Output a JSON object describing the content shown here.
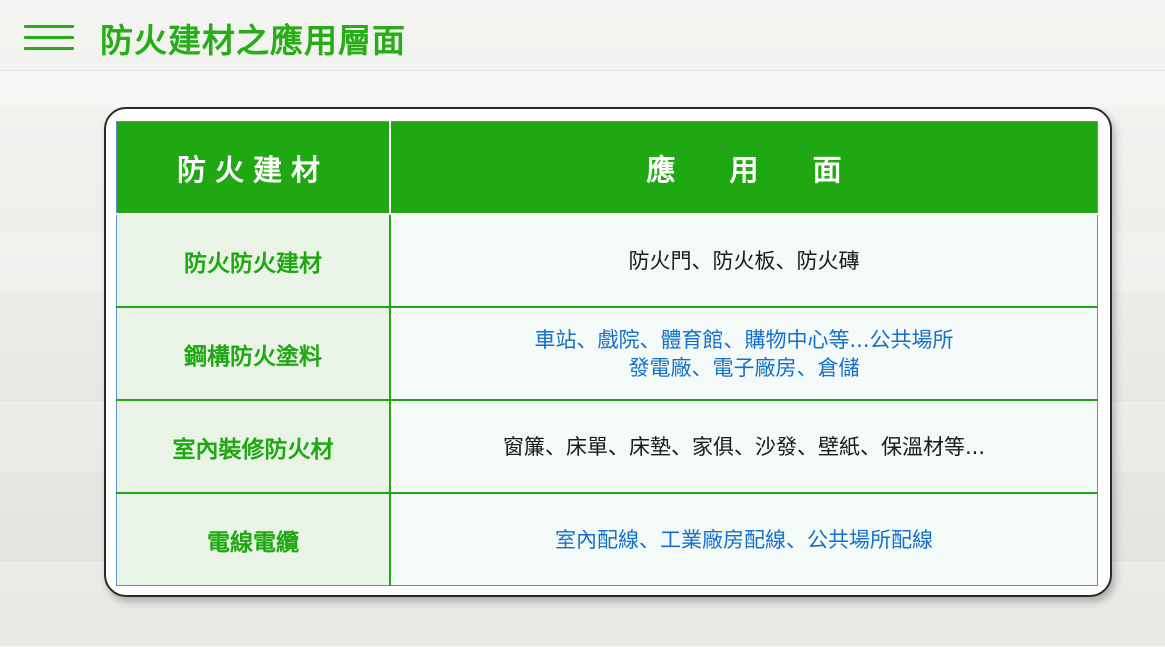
{
  "header": {
    "title": "防火建材之應用層面",
    "menu_icon": "hamburger-menu-icon"
  },
  "table": {
    "columns": {
      "material": "防火建材",
      "application": [
        "應",
        "用",
        "面"
      ]
    },
    "rows": [
      {
        "material": "防火防火建材",
        "application": [
          "防火門、防火板、防火磚"
        ],
        "application_color": "#1a1a1a"
      },
      {
        "material": "鋼構防火塗料",
        "application": [
          "車站、戲院、體育館、購物中心等...公共場所",
          "發電廠、電子廠房、倉儲"
        ],
        "application_color": "#1670c9"
      },
      {
        "material": "室內裝修防火材",
        "application": [
          "窗簾、床單、床墊、家俱、沙發、壁紙、保溫材等..."
        ],
        "application_color": "#1a1a1a"
      },
      {
        "material": "電線電纜",
        "application": [
          "室內配線、工業廠房配線、公共場所配線"
        ],
        "application_color": "#1670c9"
      }
    ]
  },
  "colors": {
    "accent_green": "#1fa812",
    "title_green": "#27ad16",
    "text_blue": "#1670c9",
    "text_dark": "#1a1a1a"
  }
}
